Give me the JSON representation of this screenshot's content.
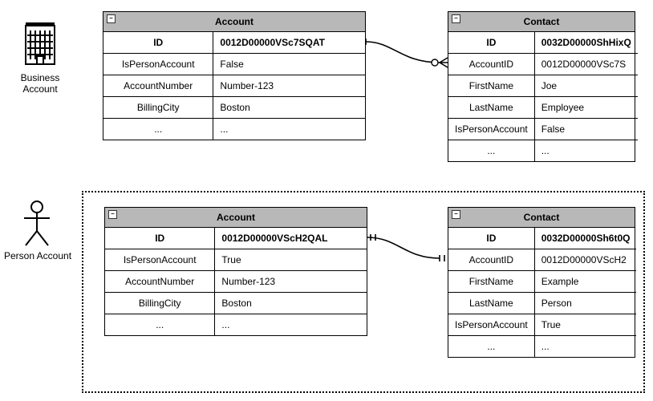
{
  "labels": {
    "business": "Business\nAccount",
    "person": "Person Account"
  },
  "top": {
    "account": {
      "title": "Account",
      "idLabel": "ID",
      "idValue": "0012D00000VSc7SQAT",
      "rows": [
        {
          "k": "IsPersonAccount",
          "v": "False"
        },
        {
          "k": "AccountNumber",
          "v": "Number-123"
        },
        {
          "k": "BillingCity",
          "v": "Boston"
        },
        {
          "k": "...",
          "v": "..."
        }
      ]
    },
    "contact": {
      "title": "Contact",
      "idLabel": "ID",
      "idValue": "0032D00000ShHixQ",
      "rows": [
        {
          "k": "AccountID",
          "v": "0012D00000VSc7S"
        },
        {
          "k": "FirstName",
          "v": "Joe"
        },
        {
          "k": "LastName",
          "v": "Employee"
        },
        {
          "k": "IsPersonAccount",
          "v": "False"
        },
        {
          "k": "...",
          "v": "..."
        }
      ]
    }
  },
  "bottom": {
    "account": {
      "title": "Account",
      "idLabel": "ID",
      "idValue": "0012D00000VScH2QAL",
      "rows": [
        {
          "k": "IsPersonAccount",
          "v": "True"
        },
        {
          "k": "AccountNumber",
          "v": "Number-123"
        },
        {
          "k": "BillingCity",
          "v": "Boston"
        },
        {
          "k": "...",
          "v": "..."
        }
      ]
    },
    "contact": {
      "title": "Contact",
      "idLabel": "ID",
      "idValue": "0032D00000Sh6t0Q",
      "rows": [
        {
          "k": "AccountID",
          "v": "0012D00000VScH2"
        },
        {
          "k": "FirstName",
          "v": "Example"
        },
        {
          "k": "LastName",
          "v": "Person"
        },
        {
          "k": "IsPersonAccount",
          "v": "True"
        },
        {
          "k": "...",
          "v": "..."
        }
      ]
    }
  }
}
